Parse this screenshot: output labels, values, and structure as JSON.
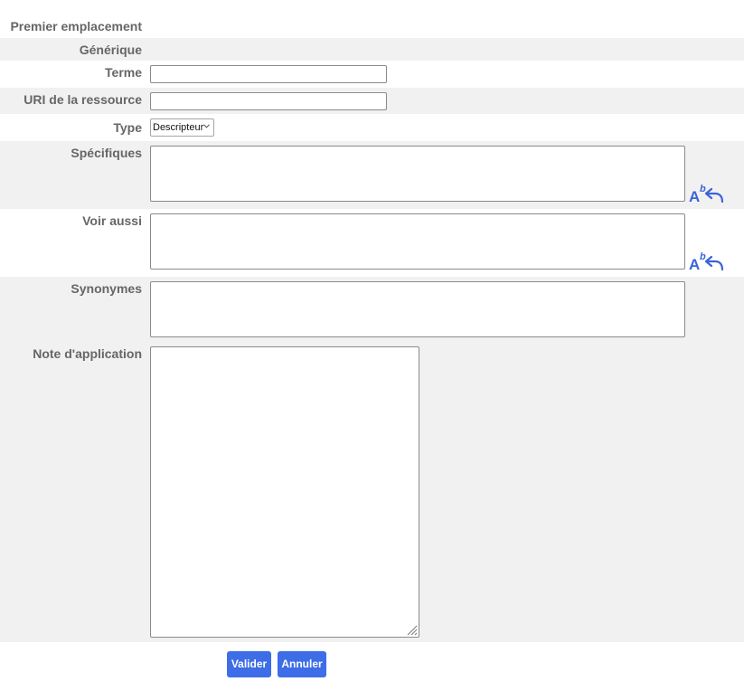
{
  "form": {
    "premier_emplacement_label": "Premier emplacement",
    "generique_label": "Générique",
    "terme_label": "Terme",
    "terme_value": "",
    "uri_label": "URI de la ressource",
    "uri_value": "",
    "type_label": "Type",
    "type_selected": "Descripteur",
    "specifiques_label": "Spécifiques",
    "voir_aussi_label": "Voir aussi",
    "synonymes_label": "Synonymes",
    "note_label": "Note d'application",
    "icon_letter_A": "A",
    "icon_letter_b": "b"
  },
  "buttons": {
    "valider": "Valider",
    "annuler": "Annuler"
  },
  "colors": {
    "accent": "#3d6de7",
    "row_alt": "#f1f1f1"
  }
}
